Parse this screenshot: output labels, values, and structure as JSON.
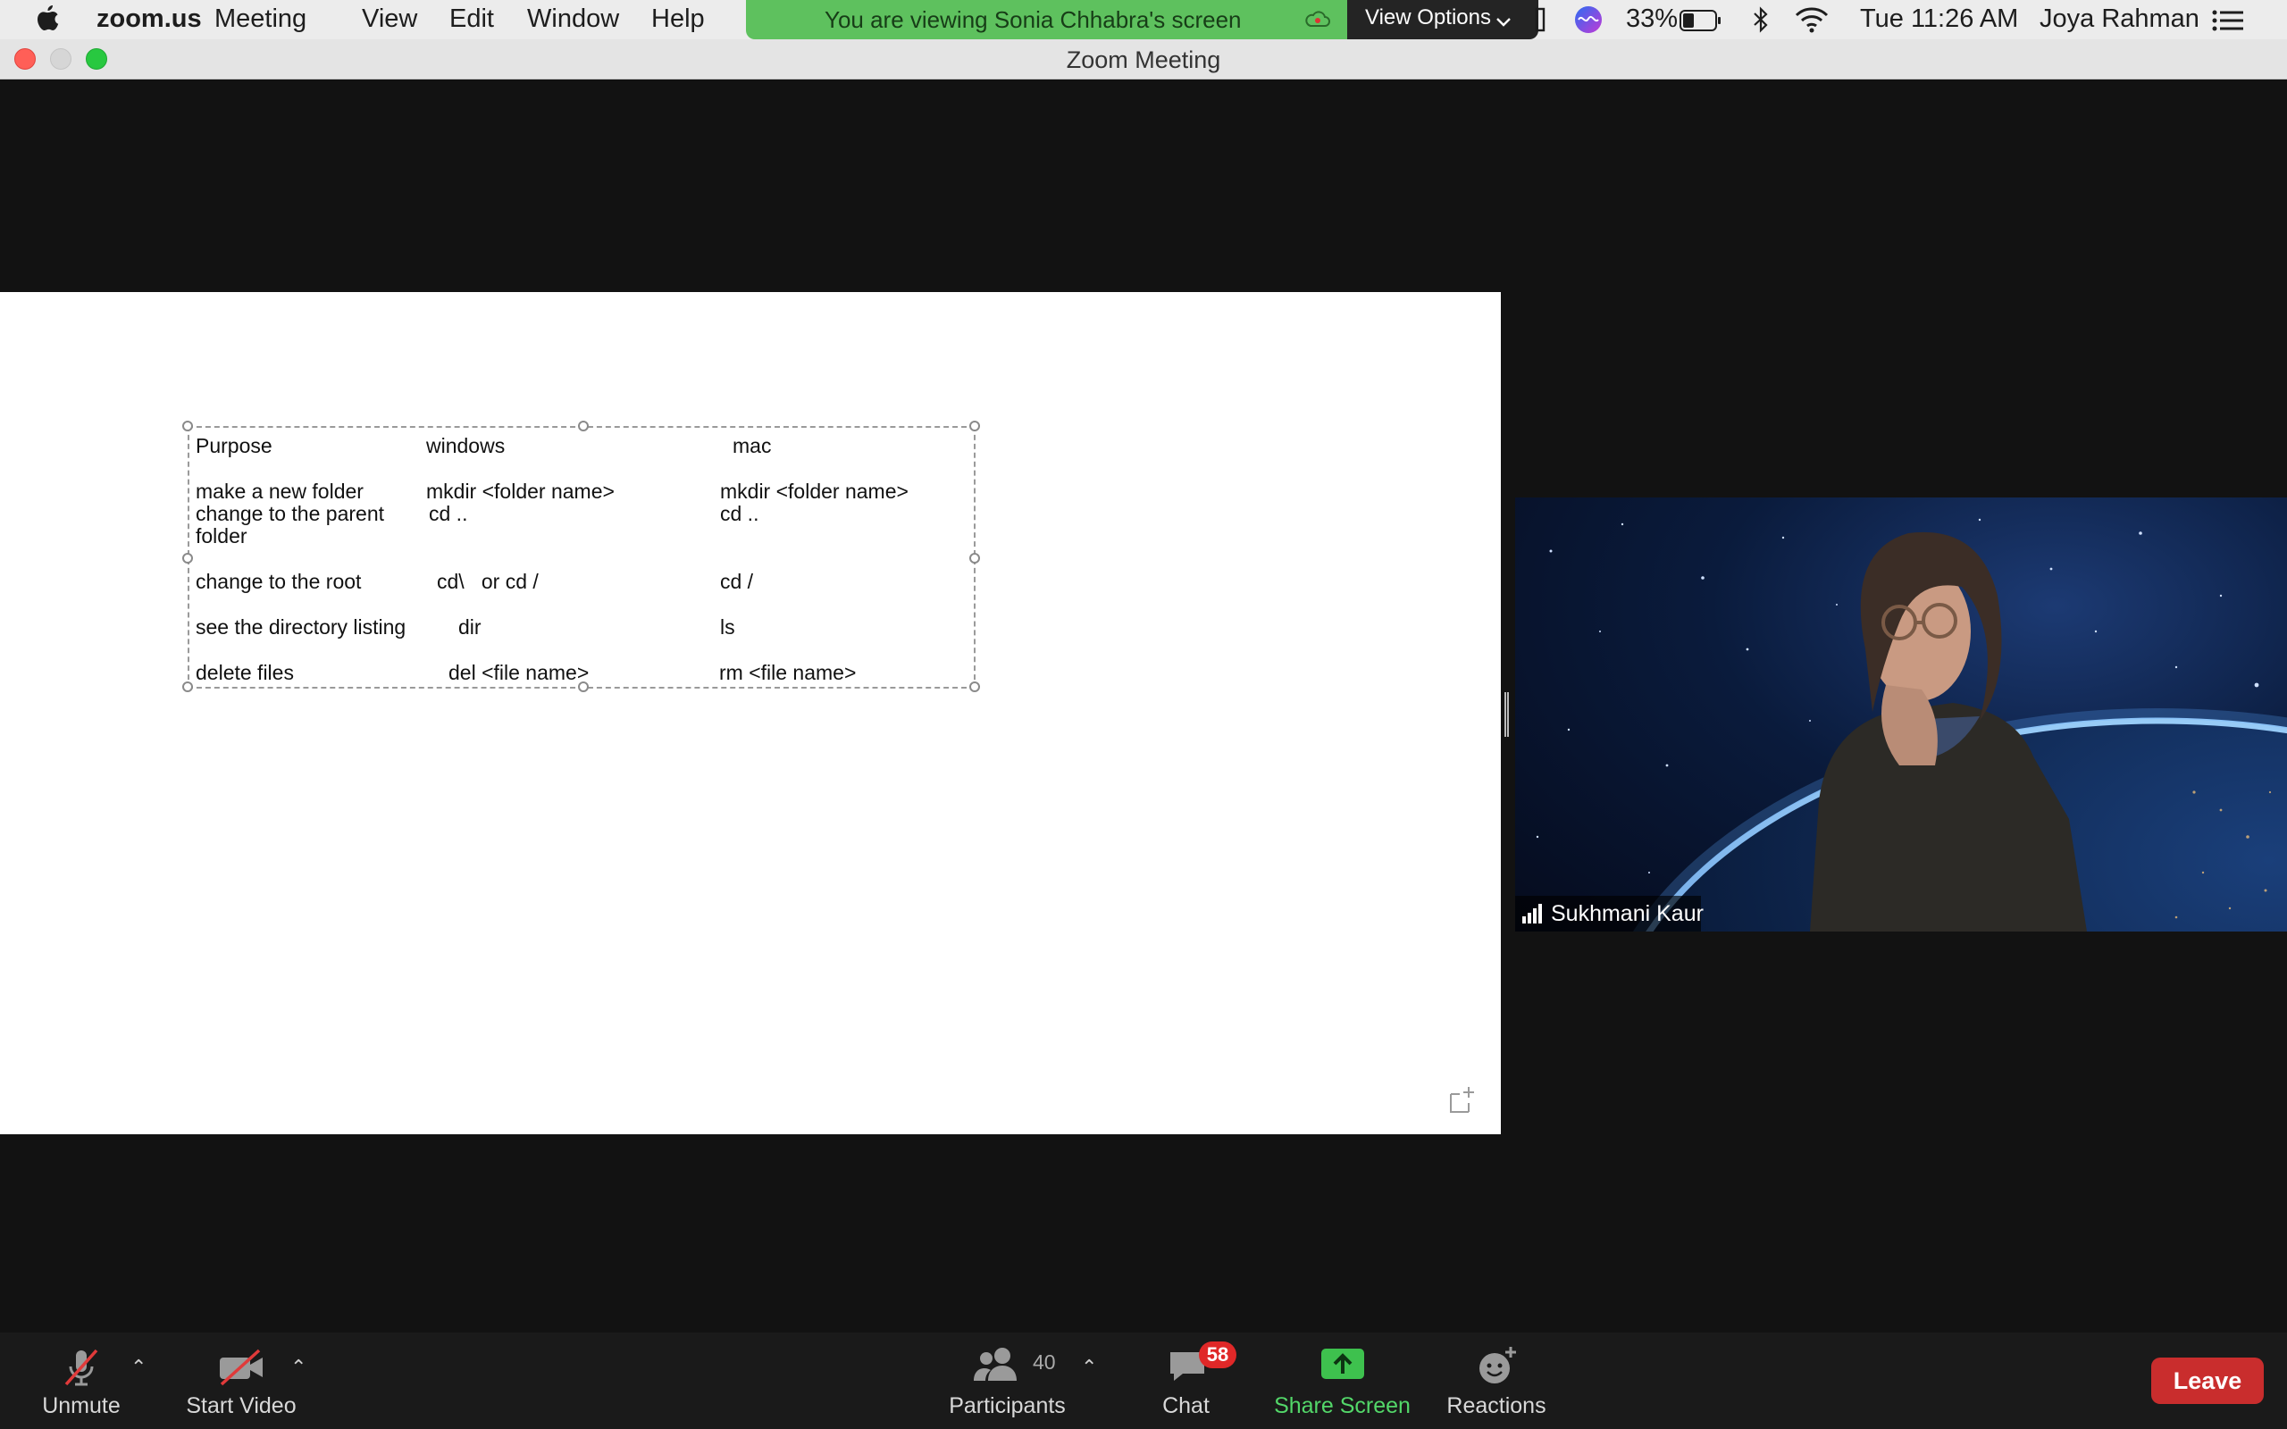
{
  "menubar": {
    "app_name": "zoom.us",
    "items": [
      "Meeting",
      "View",
      "Edit",
      "Window",
      "Help"
    ],
    "battery_percent": "33%",
    "clock": "Tue 11:26 AM",
    "user": "Joya Rahman"
  },
  "banner": {
    "text": "You are viewing Sonia Chhabra's screen",
    "view_options": "View Options"
  },
  "window": {
    "title": "Zoom Meeting"
  },
  "shared_table": {
    "header": {
      "purpose": "Purpose",
      "windows": "windows",
      "mac": "mac"
    },
    "rows": [
      {
        "purpose": "make a new folder",
        "windows": "mkdir <folder name>",
        "mac": "mkdir <folder name>"
      },
      {
        "purpose_line1": "change to the parent",
        "purpose_line2": "folder",
        "windows": "cd ..",
        "mac": "cd .."
      },
      {
        "purpose": "change to the root",
        "windows": "cd\\   or cd /",
        "mac": "cd /"
      },
      {
        "purpose": "see the directory listing",
        "windows": "dir",
        "mac": "ls"
      },
      {
        "purpose": "delete files",
        "windows": "del <file name>",
        "mac": "rm <file name>"
      }
    ]
  },
  "video": {
    "participant_name": "Sukhmani Kaur"
  },
  "toolbar": {
    "unmute": "Unmute",
    "start_video": "Start Video",
    "participants": "Participants",
    "participants_count": "40",
    "chat": "Chat",
    "chat_badge": "58",
    "share_screen": "Share Screen",
    "reactions": "Reactions",
    "leave": "Leave"
  },
  "colors": {
    "banner_green": "#5ec15e",
    "share_green": "#53d769",
    "leave_red": "#c92d2d",
    "badge_red": "#e02828"
  }
}
